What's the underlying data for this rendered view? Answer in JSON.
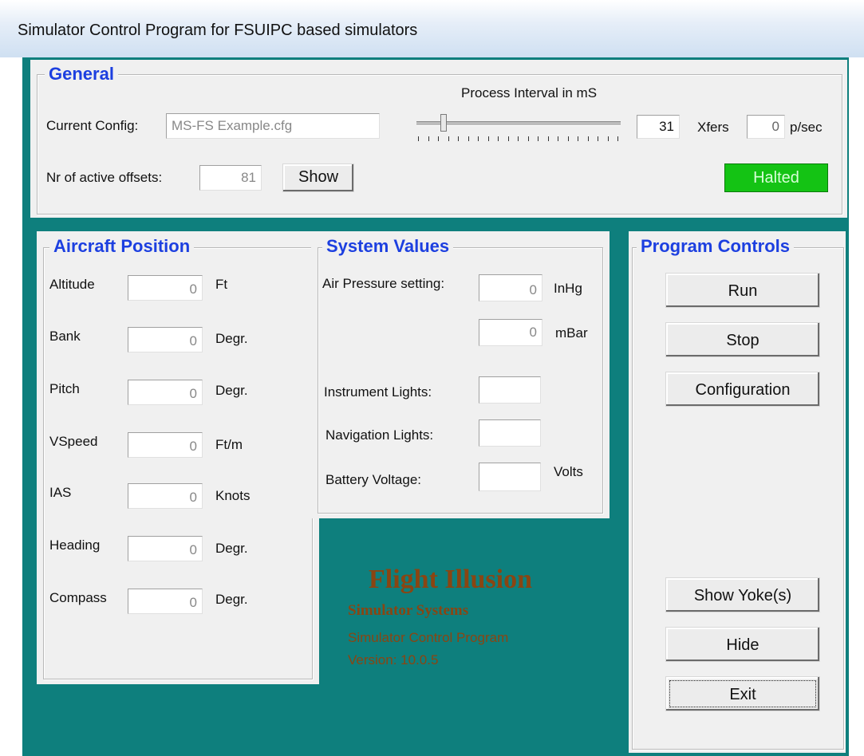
{
  "window": {
    "title": "Simulator Control Program for FSUIPC based simulators"
  },
  "general": {
    "title": "General",
    "config_label": "Current Config:",
    "config_value": "MS-FS Example.cfg",
    "interval_label": "Process Interval in mS",
    "interval_value": "31",
    "interval_slider_fraction": 0.12,
    "xfers_label": "Xfers",
    "xfers_value": "0",
    "psec_label": "p/sec",
    "offsets_label": "Nr of active offsets:",
    "offsets_value": "81",
    "show_label": "Show",
    "status": "Halted",
    "status_color": "#14c314"
  },
  "aircraft": {
    "title": "Aircraft Position",
    "rows": [
      {
        "label": "Altitude",
        "value": "0",
        "unit": "Ft"
      },
      {
        "label": "Bank",
        "value": "0",
        "unit": "Degr."
      },
      {
        "label": "Pitch",
        "value": "0",
        "unit": "Degr."
      },
      {
        "label": "VSpeed",
        "value": "0",
        "unit": "Ft/m"
      },
      {
        "label": "IAS",
        "value": "0",
        "unit": "Knots"
      },
      {
        "label": "Heading",
        "value": "0",
        "unit": "Degr."
      },
      {
        "label": "Compass",
        "value": "0",
        "unit": "Degr."
      }
    ]
  },
  "system": {
    "title": "System Values",
    "air_pressure_label": "Air Pressure setting:",
    "air_pressure_inhg": "0",
    "inhg_unit": "InHg",
    "air_pressure_mbar": "0",
    "mbar_unit": "mBar",
    "instrument_lights_label": "Instrument Lights:",
    "instrument_lights_value": "",
    "navigation_lights_label": "Navigation Lights:",
    "navigation_lights_value": "",
    "battery_label": "Battery Voltage:",
    "battery_value": "",
    "volts_unit": "Volts"
  },
  "controls": {
    "title": "Program Controls",
    "run": "Run",
    "stop": "Stop",
    "configuration": "Configuration",
    "show_yoke": "Show Yoke(s)",
    "hide": "Hide",
    "exit": "Exit"
  },
  "brand": {
    "name": "Flight Illusion",
    "tagline": "Simulator Systems",
    "program": "Simulator Control Program",
    "version": "Version: 10.0.5",
    "color": "#8a4512",
    "accent": "#0e7f7d"
  }
}
